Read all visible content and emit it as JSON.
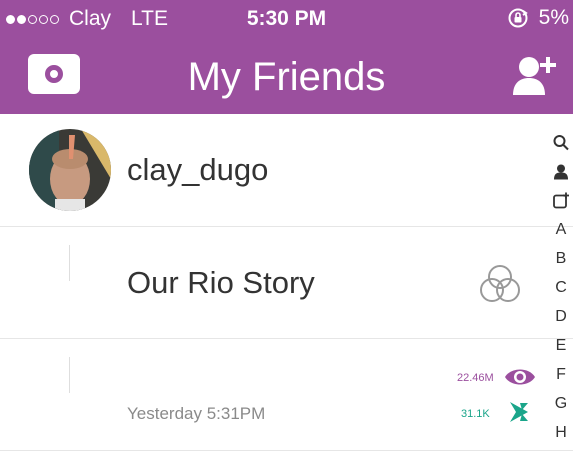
{
  "status_bar": {
    "carrier": "Clay",
    "network": "LTE",
    "time": "5:30 PM",
    "battery": "5%",
    "signal_bars_filled": 2,
    "signal_bars_total": 5
  },
  "header": {
    "title": "My Friends",
    "background_color": "#9b4f9e",
    "camera_icon": "camera-icon",
    "add_friend_icon": "add-friend-icon"
  },
  "friends": [
    {
      "username": "clay_dugo"
    }
  ],
  "story": {
    "title": "Our Rio Story",
    "icon": "story-rings-icon",
    "timestamp": "Yesterday 5:31PM",
    "views": "22.46M",
    "screenshots": "31.1K",
    "views_color": "#9b4f9e",
    "screenshots_color": "#1aa58a"
  },
  "index": {
    "icons": [
      "search-icon",
      "person-icon",
      "add-story-icon"
    ],
    "letters": [
      "A",
      "B",
      "C",
      "D",
      "E",
      "F",
      "G",
      "H"
    ]
  }
}
